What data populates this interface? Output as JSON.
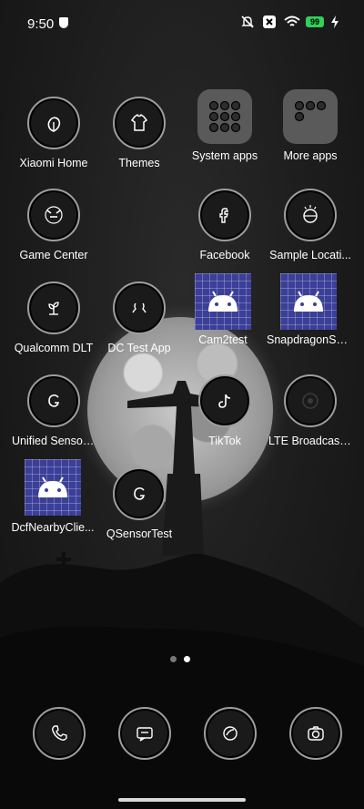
{
  "status_bar": {
    "time": "9:50",
    "battery": "99"
  },
  "apps": [
    {
      "label": "Xiaomi Home",
      "icon": "leaf-icon"
    },
    {
      "label": "Themes",
      "icon": "shirt-icon"
    },
    {
      "label": "System apps",
      "icon": "folder-icon"
    },
    {
      "label": "More apps",
      "icon": "folder-icon"
    },
    {
      "label": "Game Center",
      "icon": "game-icon"
    },
    {
      "label": "Facebook",
      "icon": "facebook-icon"
    },
    {
      "label": "Sample Locati...",
      "icon": "location-icon"
    },
    {
      "label": "Qualcomm DLT",
      "icon": "plant-icon"
    },
    {
      "label": "DC Test App",
      "icon": "bracket-icon"
    },
    {
      "label": "Cam2test",
      "icon": "android-icon"
    },
    {
      "label": "SnapdragonSD...",
      "icon": "android-icon"
    },
    {
      "label": "Unified Sensor ...",
      "icon": "sensor-icon"
    },
    {
      "label": "TikTok",
      "icon": "tiktok-icon"
    },
    {
      "label": "LTE Broadcast ...",
      "icon": "broadcast-icon"
    },
    {
      "label": "DcfNearbyClie...",
      "icon": "android-icon"
    },
    {
      "label": "QSensorTest",
      "icon": "sensor-icon"
    }
  ],
  "dock": [
    {
      "name": "phone",
      "icon": "phone-icon"
    },
    {
      "name": "messages",
      "icon": "message-icon"
    },
    {
      "name": "browser",
      "icon": "browser-icon"
    },
    {
      "name": "camera",
      "icon": "camera-icon"
    }
  ],
  "page_indicator": {
    "pages": 2,
    "current": 2
  },
  "colors": {
    "battery": "#31d059",
    "android_bg": "#3b3f98"
  }
}
